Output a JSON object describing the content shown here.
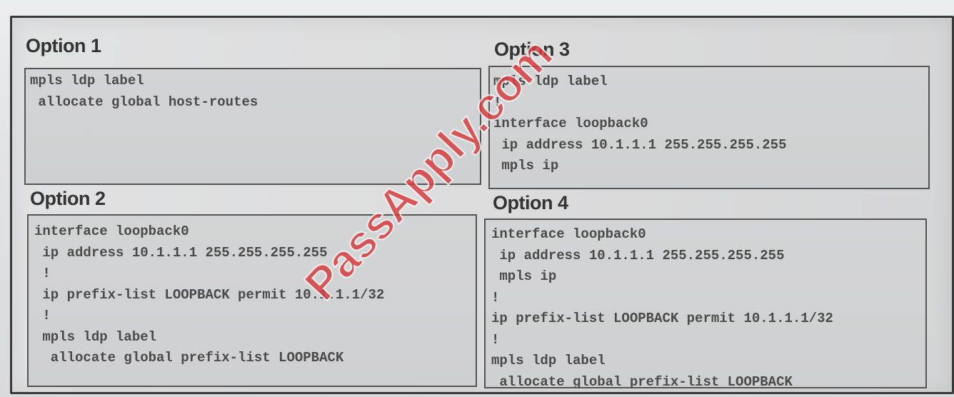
{
  "options": [
    {
      "title": "Option 1",
      "lines": [
        "mpls ldp label",
        " allocate global host-routes"
      ]
    },
    {
      "title": "Option 2",
      "lines": [
        "interface loopback0",
        " ip address 10.1.1.1 255.255.255.255",
        " !",
        " ip prefix-list LOOPBACK permit 10.1.1.1/32",
        " !",
        " mpls ldp label",
        "  allocate global prefix-list LOOPBACK"
      ]
    },
    {
      "title": "Option 3",
      "lines": [
        "mpls ldp label",
        "!",
        "interface loopback0",
        " ip address 10.1.1.1 255.255.255.255",
        " mpls ip"
      ]
    },
    {
      "title": "Option 4",
      "lines": [
        "interface loopback0",
        " ip address 10.1.1.1 255.255.255.255",
        " mpls ip",
        "!",
        "ip prefix-list LOOPBACK permit 10.1.1.1/32",
        "!",
        "mpls ldp label",
        " allocate global prefix-list LOOPBACK"
      ]
    }
  ],
  "watermark": "PassApply.com"
}
